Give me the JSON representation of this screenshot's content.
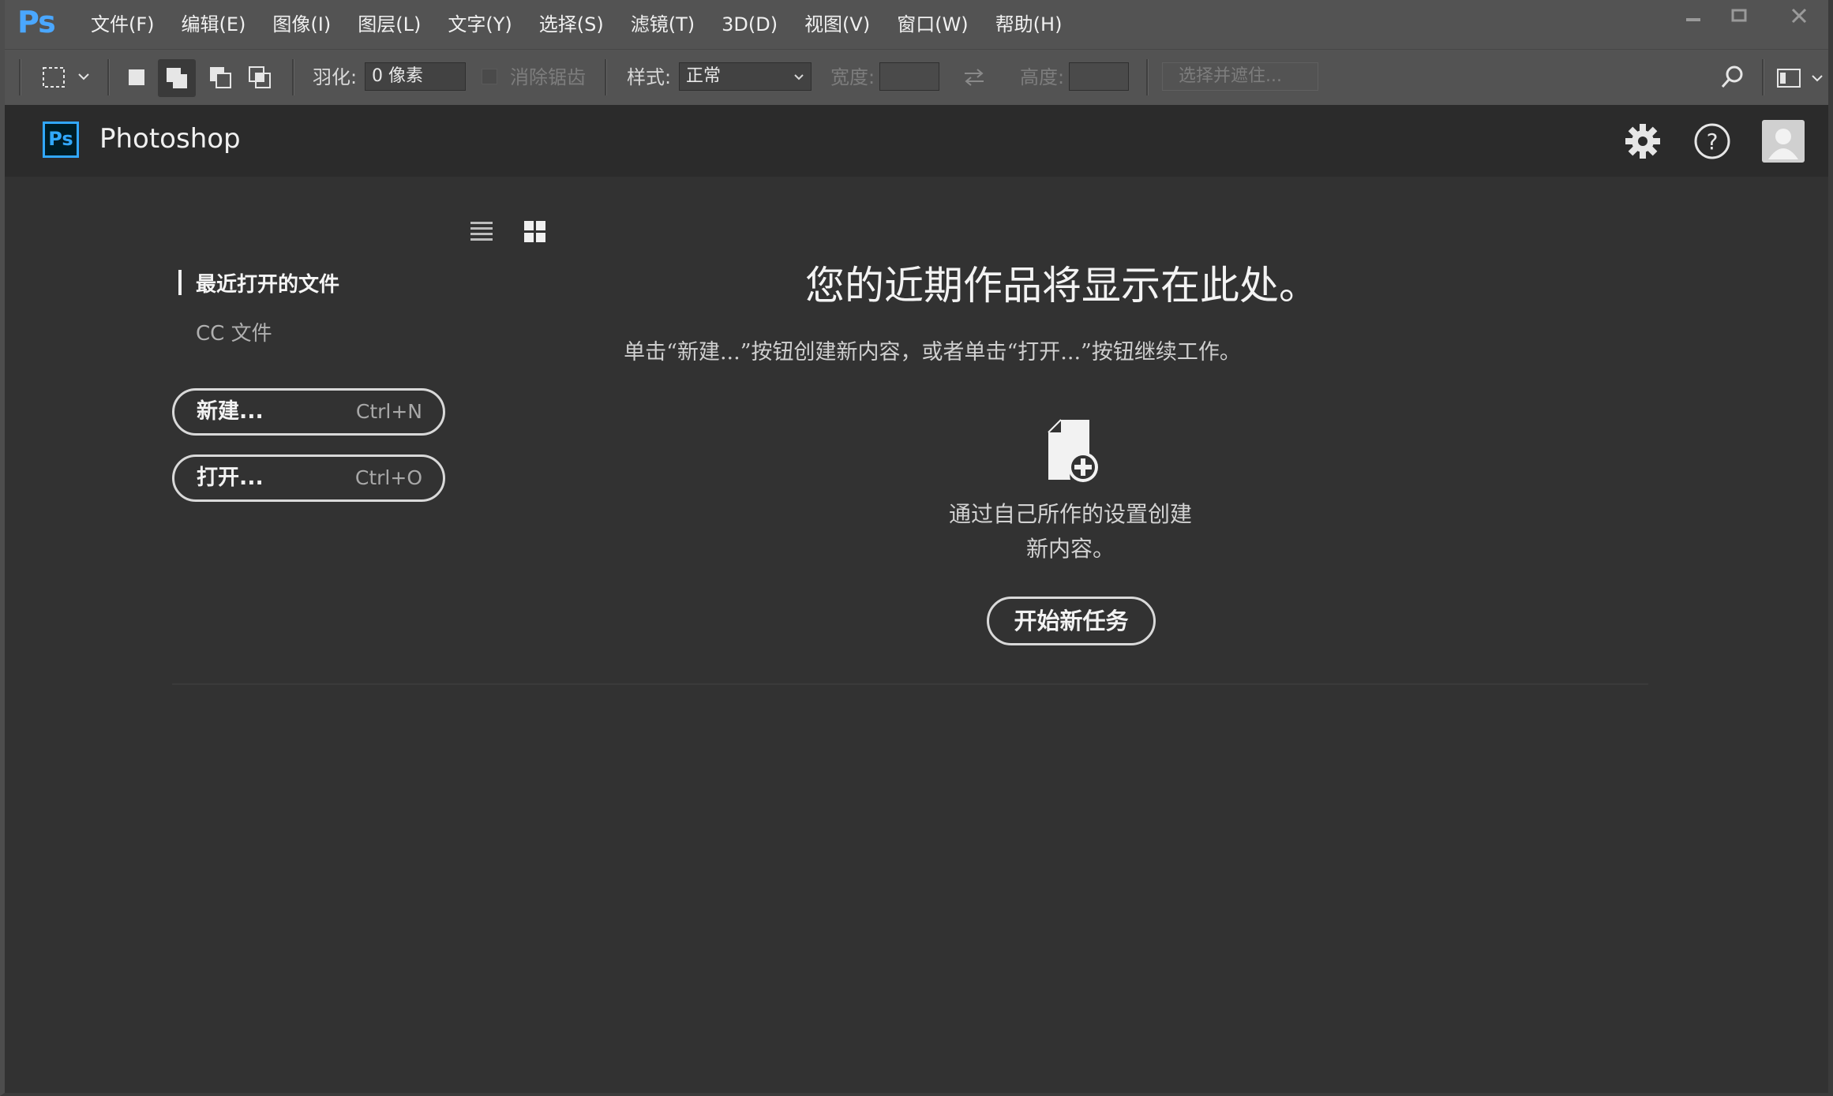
{
  "menubar": {
    "logo": "Ps",
    "items": [
      "文件(F)",
      "编辑(E)",
      "图像(I)",
      "图层(L)",
      "文字(Y)",
      "选择(S)",
      "滤镜(T)",
      "3D(D)",
      "视图(V)",
      "窗口(W)",
      "帮助(H)"
    ]
  },
  "options": {
    "feather_label": "羽化:",
    "feather_value": "0 像素",
    "antialias_label": "消除锯齿",
    "style_label": "样式:",
    "style_value": "正常",
    "width_label": "宽度:",
    "height_label": "高度:",
    "select_mask_label": "选择并遮住..."
  },
  "header": {
    "badge": "Ps",
    "title": "Photoshop"
  },
  "sidebar": {
    "active_item": "最近打开的文件",
    "cc_files": "CC 文件",
    "new_button": {
      "label": "新建...",
      "shortcut": "Ctrl+N"
    },
    "open_button": {
      "label": "打开...",
      "shortcut": "Ctrl+O"
    }
  },
  "main": {
    "headline": "您的近期作品将显示在此处。",
    "subline": "单击“新建...”按钮创建新内容，或者单击“打开...”按钮继续工作。",
    "create_line1": "通过自己所作的设置创建",
    "create_line2": "新内容。",
    "start_button": "开始新任务"
  },
  "colors": {
    "brand": "#31a8ff",
    "background": "#323232",
    "header": "#2b2b2b",
    "toolbar": "#535353"
  }
}
